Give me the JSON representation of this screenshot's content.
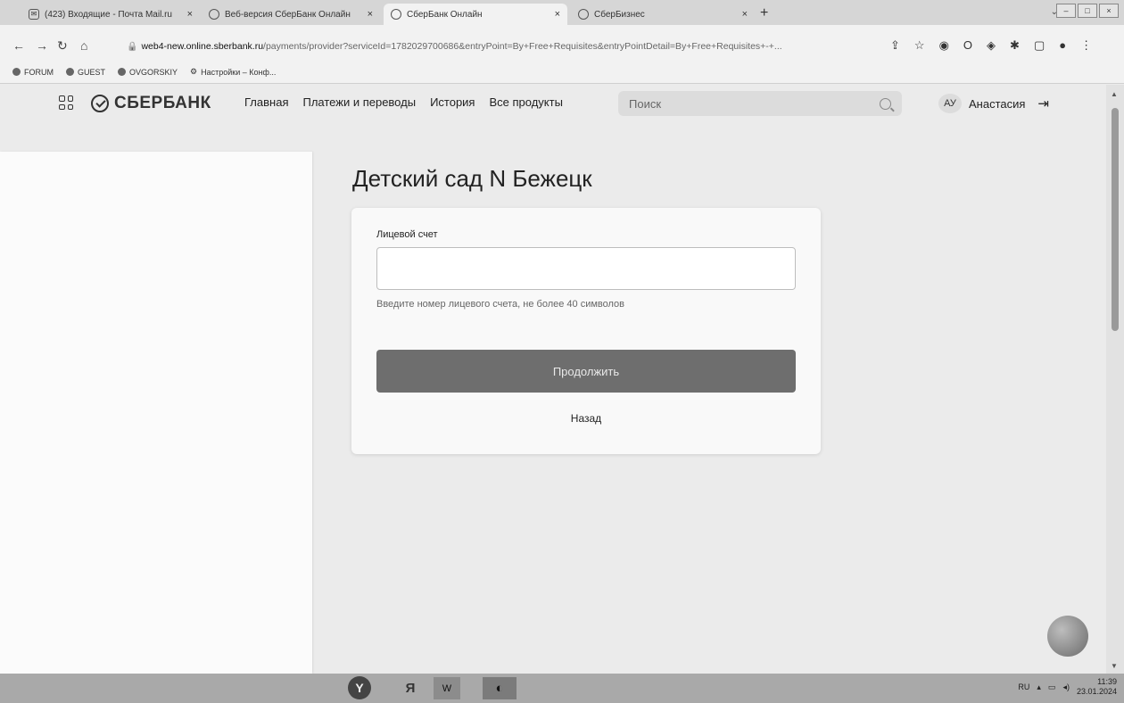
{
  "browser": {
    "tabs": [
      {
        "title": "(423) Входящие - Почта Mail.ru",
        "icon": "mail-icon",
        "active": false
      },
      {
        "title": "Веб-версия СберБанк Онлайн",
        "icon": "sber-icon",
        "active": false
      },
      {
        "title": "СберБанк Онлайн",
        "icon": "sber-icon",
        "active": true
      },
      {
        "title": "СберБизнес",
        "icon": "sber-icon",
        "active": false
      }
    ],
    "new_tab": "+",
    "url_host": "web4-new.online.sberbank.ru",
    "url_path": "/payments/provider?serviceId=1782029700686&entryPoint=By+Free+Requisites&entryPointDetail=By+Free+Requisites+-+...",
    "bookmarks": [
      {
        "label": "FORUM"
      },
      {
        "label": "GUEST"
      },
      {
        "label": "OVGORSKIY"
      },
      {
        "label": "Настройки – Конф..."
      }
    ]
  },
  "header": {
    "logo": "СБЕРБАНК",
    "nav": [
      "Главная",
      "Платежи и переводы",
      "История",
      "Все продукты"
    ],
    "search_placeholder": "Поиск",
    "user_initials": "АУ",
    "user_name": "Анастасия"
  },
  "main": {
    "title": "Детский сад N  Бежецк",
    "account_label": "Лицевой счет",
    "account_value": "",
    "account_hint": "Введите номер лицевого счета, не более 40 символов",
    "continue_label": "Продолжить",
    "back_label": "Назад"
  },
  "taskbar": {
    "yandex_browser": "Y",
    "yandex": "Я",
    "word": "W",
    "lang": "RU",
    "time": "11:39",
    "date": "23.01.2024"
  }
}
